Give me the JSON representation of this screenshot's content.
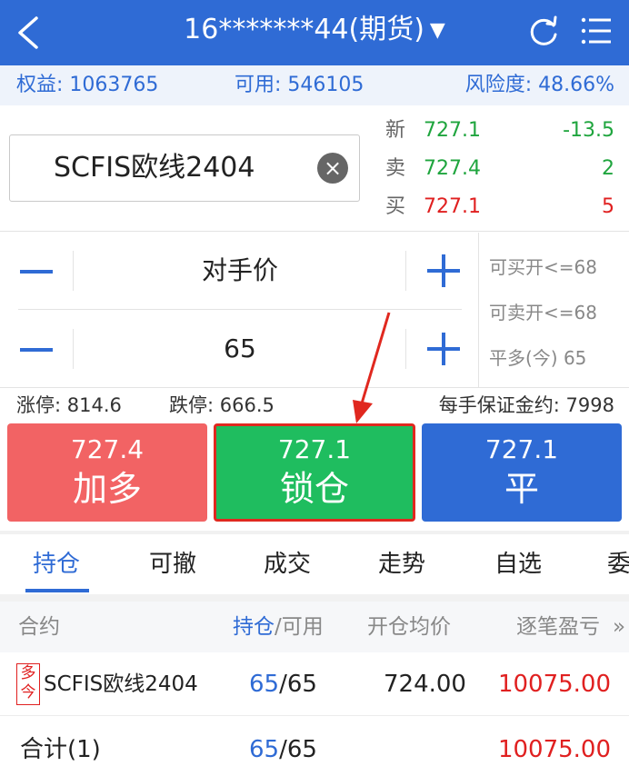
{
  "header": {
    "title": "16*******44(期货)",
    "caret": "▼",
    "back_icon": "chevron-left-icon",
    "refresh_icon": "refresh-icon",
    "menu_icon": "list-menu-icon",
    "bg_color": "#2f6bd5"
  },
  "account": {
    "equity": "权益: 1063765",
    "available": "可用: 546105",
    "risk": "风险度: 48.66%"
  },
  "contract": {
    "name": "SCFIS欧线2404",
    "clear_icon": "×"
  },
  "quotes": [
    {
      "label": "新",
      "price": "727.1",
      "change": "-13.5"
    },
    {
      "label": "卖",
      "price": "727.4",
      "change": "2"
    },
    {
      "label": "买",
      "price": "727.1",
      "change": "5"
    }
  ],
  "order": {
    "price_mode": "对手价",
    "quantity": "65"
  },
  "side_info": {
    "buy_open": "可买开<=68",
    "sell_open": "可卖开<=68",
    "close_long": "平多(今) 65"
  },
  "limits": {
    "limit_up": "涨停: 814.6",
    "limit_down": "跌停: 666.5",
    "margin": "每手保证金约: 7998"
  },
  "actions": {
    "add_long": {
      "price": "727.4",
      "label": "加多"
    },
    "lock": {
      "price": "727.1",
      "label": "锁仓"
    },
    "close": {
      "price": "727.1",
      "label": "平"
    }
  },
  "tabs": [
    "持仓",
    "可撤",
    "成交",
    "走势",
    "自选",
    "委"
  ],
  "table": {
    "headers": {
      "contract": "合约",
      "position_a": "持仓",
      "position_b": "/可用",
      "avg_price": "开仓均价",
      "pnl": "逐笔盈亏",
      "more": "»"
    },
    "rows": [
      {
        "badge_top": "多",
        "badge_bottom": "今",
        "contract": "SCFIS欧线2404",
        "pos": "65",
        "avail": "/65",
        "avg": "724.00",
        "pnl": "10075.00"
      }
    ],
    "total": {
      "label": "合计(1)",
      "pos": "65",
      "avail": "/65",
      "pnl": "10075.00"
    }
  },
  "colors": {
    "accent": "#2f6bd5",
    "up": "#e02020",
    "down": "#1fa53e",
    "add_btn": "#f26364",
    "lock_btn": "#1fbd5f"
  }
}
